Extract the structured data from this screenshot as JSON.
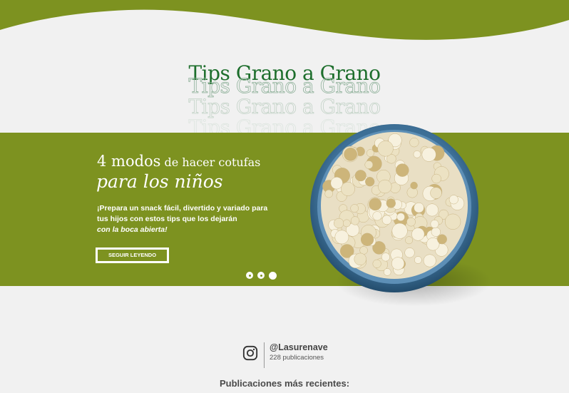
{
  "header": {
    "accent_color": "#7d9220",
    "background": "#f1f1f1"
  },
  "title": "Tips Grano a Grano",
  "hero": {
    "headline_part1": "4 modos",
    "headline_part2": " de hacer cotufas",
    "headline_line2": "para los niños",
    "description": "¡Prepara un snack fácil, divertido y variado para tus hijos con estos tips que los dejarán",
    "description_em": "con la boca abierta!",
    "button_label": "SEGUIR LEYENDO",
    "image_icon": "popcorn-bowl-image",
    "slides_total": 3,
    "slide_active": 3
  },
  "instagram": {
    "icon": "instagram-icon",
    "handle": "@Lasurenave",
    "posts": "228 publicaciones"
  },
  "recent_heading": "Publicaciones más recientes:"
}
